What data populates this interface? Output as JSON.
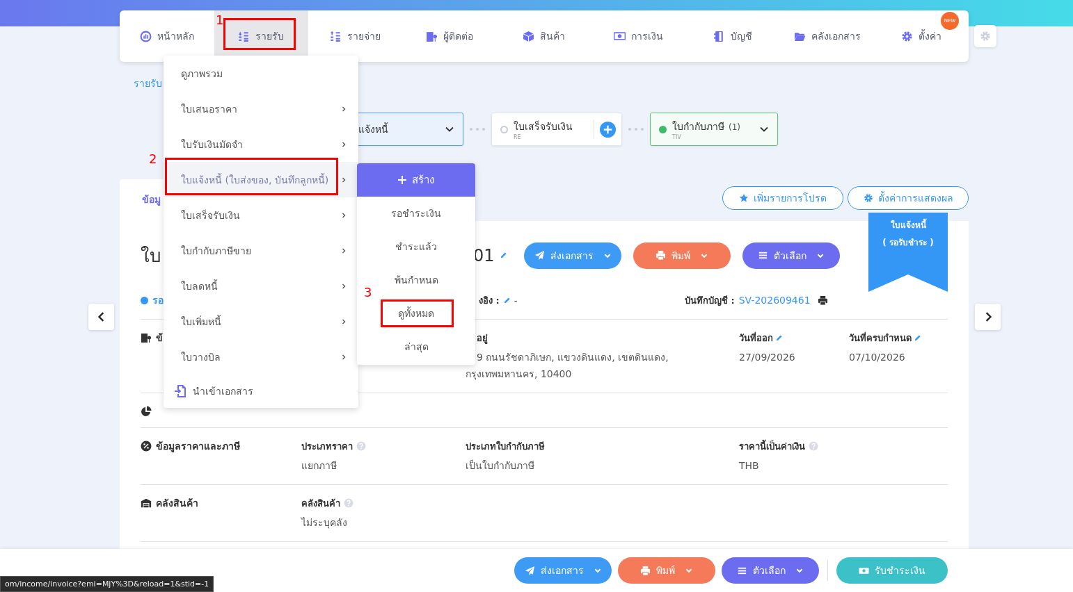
{
  "nav": {
    "items": [
      {
        "label": "หน้าหลัก",
        "selected": false
      },
      {
        "label": "รายรับ",
        "selected": true
      },
      {
        "label": "รายจ่าย",
        "selected": false
      },
      {
        "label": "ผู้ติดต่อ",
        "selected": false
      },
      {
        "label": "สินค้า",
        "selected": false
      },
      {
        "label": "การเงิน",
        "selected": false
      },
      {
        "label": "บัญชี",
        "selected": false
      },
      {
        "label": "คลังเอกสาร",
        "selected": false
      },
      {
        "label": "ตั้งค่า",
        "selected": false,
        "badge": "NEW"
      }
    ]
  },
  "breadcrumb": "รายรับ",
  "flow_steps": [
    {
      "label": "แจ้งหนี้",
      "kind": "dropdown",
      "selected": true
    },
    {
      "label": "ใบเสร็จรับเงิน",
      "code": "RE",
      "kind": "add",
      "selected": false,
      "done": false
    },
    {
      "label": "ใบกำกับภาษี",
      "count": "(1)",
      "code": "TIV",
      "kind": "dropdown",
      "selected": false,
      "done": true
    }
  ],
  "tabs": [
    {
      "label": "ข้อมู",
      "selected": true
    }
  ],
  "tab_actions": [
    {
      "label": "เพิ่มรายการโปรด",
      "kind": "favorite"
    },
    {
      "label": "ตั้งค่าการแสดงผล",
      "kind": "settings"
    }
  ],
  "document": {
    "title": "ใบ",
    "number": "01",
    "status": {
      "label": "รอ",
      "color": "#3597f5"
    },
    "reference": {
      "label": "งอิง :",
      "value": "-"
    },
    "journal": {
      "label": "บันทึกบัญชี :",
      "value": "SV-202609461"
    },
    "ribbon": {
      "title": "ใบแจ้งหนี้",
      "status": "( รอรับชำระ )"
    },
    "actions": [
      {
        "label": "ส่งเอกสาร",
        "kind": "send"
      },
      {
        "label": "พิมพ์",
        "kind": "print"
      },
      {
        "label": "ตัวเลือก",
        "kind": "options"
      }
    ],
    "sections": [
      {
        "kind": "customer",
        "title": "ข้",
        "fields": [
          {
            "label": "อยู่",
            "lines": [
              "9 ถนนรัชดาภิเษก, แขวงดินแดง, เขตดินแดง,",
              "กรุงเทพมหานคร, 10400"
            ],
            "help": false,
            "editable": false
          },
          {
            "label": "วันที่ออก",
            "lines": [
              "27/09/2026"
            ],
            "help": false,
            "editable": true
          },
          {
            "label": "วันที่ครบกำหนด",
            "lines": [
              "07/10/2026"
            ],
            "help": false,
            "editable": true
          }
        ]
      },
      {
        "kind": "group"
      },
      {
        "kind": "pricing",
        "title": "ข้อมูลราคาและภาษี",
        "fields": [
          {
            "label": "ประเภทราคา",
            "lines": [
              "แยกภาษี"
            ],
            "help": true,
            "editable": false
          },
          {
            "label": "ประเภทใบกำกับภาษี",
            "lines": [
              "เป็นใบกำกับภาษี"
            ],
            "help": false,
            "editable": false
          },
          {
            "label": "ราคานี้เป็นค่าเงิน",
            "lines": [
              "THB"
            ],
            "help": true,
            "editable": false
          }
        ]
      },
      {
        "kind": "warehouse",
        "title": "คลังสินค้า",
        "fields": [
          {
            "label": "คลังสินค้า",
            "lines": [
              "ไม่ระบุคลัง"
            ],
            "help": true,
            "editable": false
          }
        ]
      }
    ]
  },
  "bottom_actions": [
    {
      "label": "ส่งเอกสาร",
      "kind": "send"
    },
    {
      "label": "พิมพ์",
      "kind": "print"
    },
    {
      "label": "ตัวเลือก",
      "kind": "options"
    },
    {
      "label": "รับชำระเงิน",
      "kind": "receive"
    }
  ],
  "income_menu": {
    "items": [
      {
        "label": "ดูภาพรวม",
        "kind": "link",
        "has_submenu": false,
        "selected": false
      },
      {
        "label": "ใบเสนอราคา",
        "kind": "link",
        "has_submenu": true,
        "selected": false
      },
      {
        "label": "ใบรับเงินมัดจำ",
        "kind": "link",
        "has_submenu": true,
        "selected": false
      },
      {
        "label": "ใบแจ้งหนี้ (ใบส่งของ, บันทึกลูกหนี้)",
        "kind": "link",
        "has_submenu": true,
        "selected": true
      },
      {
        "label": "ใบเสร็จรับเงิน",
        "kind": "link",
        "has_submenu": true,
        "selected": false
      },
      {
        "label": "ใบกำกับภาษีขาย",
        "kind": "link",
        "has_submenu": true,
        "selected": false
      },
      {
        "label": "ใบลดหนี้",
        "kind": "link",
        "has_submenu": true,
        "selected": false
      },
      {
        "label": "ใบเพิ่มหนี้",
        "kind": "link",
        "has_submenu": true,
        "selected": false
      },
      {
        "label": "ใบวางบิล",
        "kind": "link",
        "has_submenu": true,
        "selected": false
      },
      {
        "label": "นำเข้าเอกสาร",
        "kind": "import",
        "has_submenu": false,
        "selected": false
      }
    ]
  },
  "submenu": {
    "create_label": "สร้าง",
    "items": [
      "รอชำระเงิน",
      "ชำระแล้ว",
      "พ้นกำหนด",
      "ดูทั้งหมด",
      "ล่าสุด"
    ]
  },
  "annotations": [
    "1",
    "2",
    "3"
  ],
  "status_url": "om/income/invoice?emi=MjY%3D&reload=1&stid=-1"
}
